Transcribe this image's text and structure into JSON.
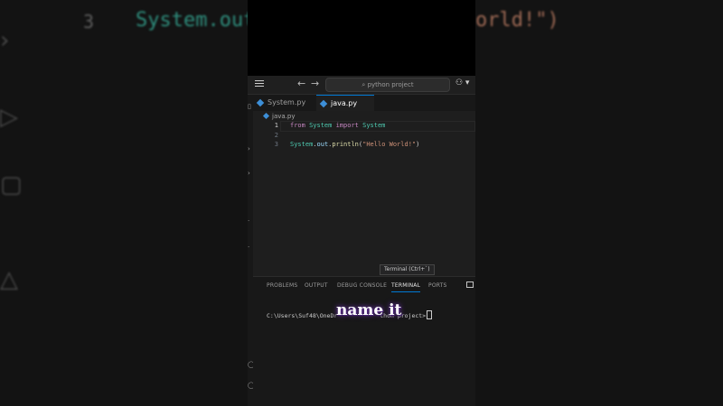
{
  "background": {
    "line_number": "3",
    "code_left": "System.out",
    "code_right": "orld!\")"
  },
  "titlebar": {
    "search_placeholder": "python project"
  },
  "tabs": [
    {
      "label": "System.py",
      "active": false
    },
    {
      "label": "java.py",
      "active": true
    }
  ],
  "breadcrumb": "java.py",
  "code_lines": [
    {
      "num": "1",
      "kw1": "from",
      "mod": "System",
      "kw2": "import",
      "cls": "System"
    },
    {
      "num": "2"
    },
    {
      "num": "3",
      "obj": "System",
      "dot1": ".",
      "field": "out",
      "dot2": ".",
      "fn": "println",
      "open": "(",
      "str": "\"Hello World!\"",
      "close": ")"
    }
  ],
  "tooltip": "Terminal (Ctrl+`)",
  "panel": {
    "tabs": [
      "PROBLEMS",
      "OUTPUT",
      "DEBUG CONSOLE",
      "TERMINAL",
      "PORTS"
    ],
    "active_tab": "TERMINAL",
    "prompt_left": "C:\\Users\\Suf48\\OneDr",
    "prompt_right": "thon project>"
  },
  "overlay_caption": "name it",
  "colors": {
    "accent": "#0078d4",
    "keyword": "#c586c0",
    "class": "#4ec9b0",
    "function": "#dcdcaa",
    "string": "#ce9178"
  }
}
